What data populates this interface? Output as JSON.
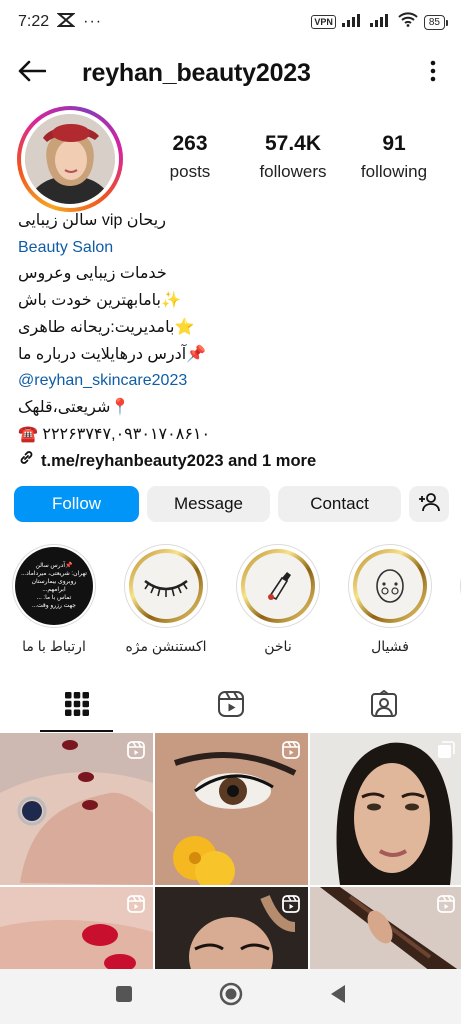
{
  "status_bar": {
    "time": "7:22",
    "vpn": "VPN",
    "battery": "85"
  },
  "header": {
    "username": "reyhan_beauty2023",
    "back_icon": "arrow-left-icon",
    "more_icon": "more-vertical-icon"
  },
  "stats": {
    "posts": {
      "value": "263",
      "label": "posts"
    },
    "followers": {
      "value": "57.4K",
      "label": "followers"
    },
    "following": {
      "value": "91",
      "label": "following"
    }
  },
  "bio": {
    "name": "ریحان vip سالن زیبایی",
    "category": "Beauty Salon",
    "lines": [
      "خدمات زیبایی وعروس",
      "✨بامابهترین خودت باش",
      "⭐بامدیریت:ریحانه طاهری",
      "📌آدرس درهایلایت درباره ما"
    ],
    "mention": "@reyhan_skincare2023",
    "location": "📍شریعتی،قلهک",
    "phone": "☎️ ۲۲۲۶۳۷۴۷,۰۹۳۰۱۷۰۸۶۱۰",
    "link": "t.me/reyhanbeauty2023 and 1 more"
  },
  "actions": {
    "follow": "Follow",
    "message": "Message",
    "contact": "Contact",
    "add_icon": "add-person-icon"
  },
  "highlights": [
    {
      "label": "ارتباط با ما",
      "cover_text": "📌آدرس سالن\nتهران: شریعتی، میرداماد...\nروبروی بیمارستان ابرامهم...\nتماس با ما: ...\nجهت رزرو وقت..."
    },
    {
      "label": "اکستنشن مژه"
    },
    {
      "label": "ناخن"
    },
    {
      "label": "فشیال"
    }
  ],
  "tabs": [
    {
      "name": "grid",
      "icon": "grid-icon"
    },
    {
      "name": "reels",
      "icon": "reels-icon"
    },
    {
      "name": "tagged",
      "icon": "tagged-person-icon"
    }
  ],
  "nav": {
    "recents_icon": "square-icon",
    "home_icon": "circle-icon",
    "back_icon": "triangle-back-icon"
  },
  "colors": {
    "accent": "#0095f6",
    "link": "#0f5da6",
    "button_bg": "#efefef"
  }
}
